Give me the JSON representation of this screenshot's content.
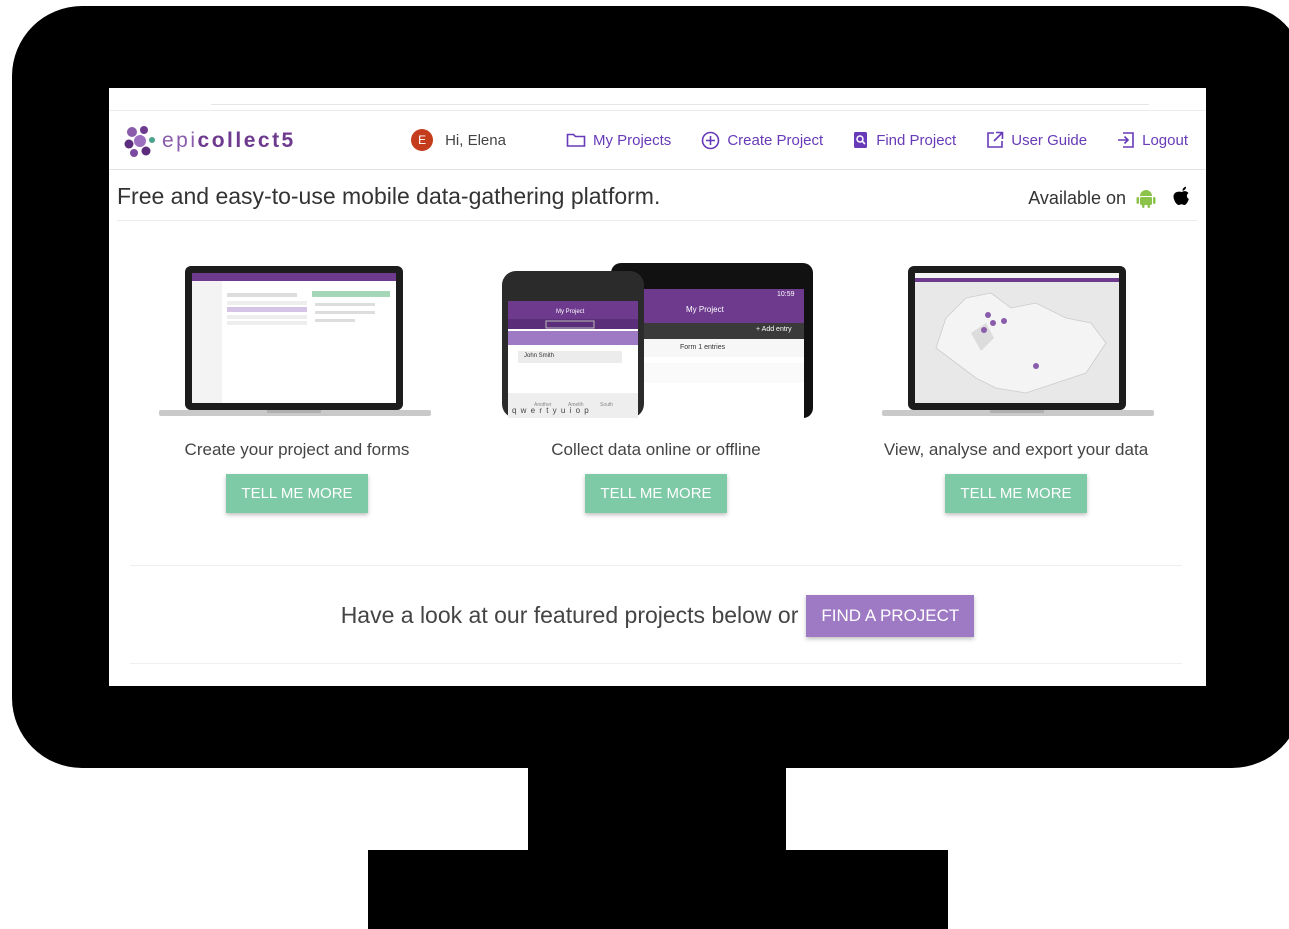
{
  "brand": {
    "logo_prefix": "epi",
    "logo_suffix": "collect5",
    "primary_color": "#673ab7",
    "green_button_color": "#7ec9a6",
    "purple_button_color": "#9e79c4"
  },
  "nav": {
    "avatar_initial": "E",
    "greeting": "Hi, Elena",
    "links": [
      {
        "label": "My Projects",
        "icon": "folder-icon"
      },
      {
        "label": "Create Project",
        "icon": "plus-circle-icon"
      },
      {
        "label": "Find Project",
        "icon": "search-document-icon"
      },
      {
        "label": "User Guide",
        "icon": "external-link-icon"
      },
      {
        "label": "Logout",
        "icon": "logout-icon"
      }
    ]
  },
  "subheader": {
    "tagline": "Free and easy-to-use mobile data-gathering platform.",
    "available_label": "Available on",
    "platform_icons": [
      "android-icon",
      "apple-icon"
    ]
  },
  "features": [
    {
      "title": "Create your project and forms",
      "button": "TELL ME MORE"
    },
    {
      "title": "Collect data online or offline",
      "button": "TELL ME MORE"
    },
    {
      "title": "View, analyse and export your data",
      "button": "TELL ME MORE"
    }
  ],
  "mockups": {
    "phone_title": "My Project",
    "phone_name": "John Smith",
    "keyboard_row": "q w e r t y u i o p",
    "tablet_title": "My Project",
    "tablet_time": "10:59",
    "tablet_add": "+ Add entry",
    "tablet_entries": "Form 1 entries"
  },
  "featured": {
    "text": "Have a look at our featured projects below or",
    "button": "FIND A PROJECT"
  }
}
